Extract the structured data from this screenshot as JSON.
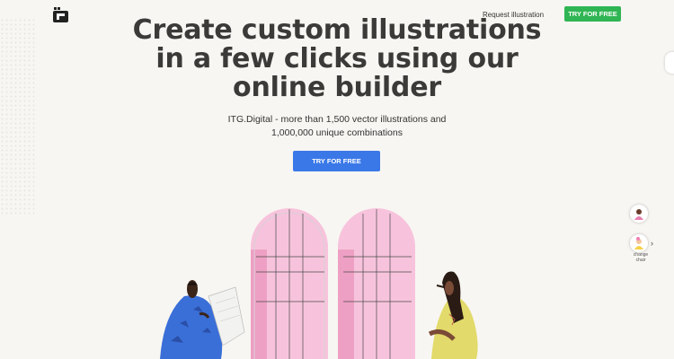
{
  "header": {
    "logo_icon": "itg-logo-icon",
    "request_link": "Request illustration",
    "try_button": "TRY FOR FREE"
  },
  "hero": {
    "headline_lines": [
      "Create custom illustrations",
      "in a few clicks using our",
      "online builder"
    ],
    "subtitle_lines": [
      "ITG.Digital - more than 1,500 vector illustrations and",
      "1,000,000 unique combinations"
    ],
    "cta": "TRY FOR FREE"
  },
  "side_panel": {
    "avatar_1_icon": "character-avatar-icon",
    "avatar_2_icon": "character-avatar-icon",
    "change_label": "change chair",
    "arrow_icon": "chevron-right-icon"
  },
  "illustration": {
    "windows_icon": "arched-window-icon",
    "left_character_icon": "person-reading-icon",
    "right_character_icon": "person-standing-icon"
  },
  "colors": {
    "background": "#f8f6f2",
    "green_cta": "#2fb553",
    "blue_cta": "#3a78e8",
    "window_pink": "#f7c3dc",
    "headline": "#3b3a38"
  }
}
